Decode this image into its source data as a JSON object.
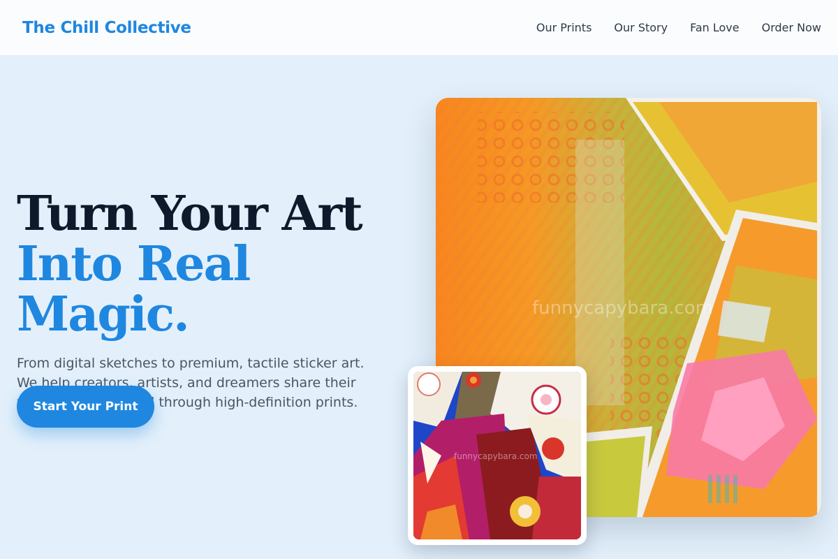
{
  "nav": {
    "brand": "The Chill Collective",
    "links": [
      "Our Prints",
      "Our Story",
      "Fan Love",
      "Order Now"
    ]
  },
  "hero": {
    "headline_line1": "Turn Your Art",
    "headline_line2": "Into Real Magic.",
    "subtext": "From digital sketches to premium, tactile sticker art. We help creators, artists, and dreamers share their vision with the world through high-definition prints.",
    "cta_label": "Start Your Print"
  },
  "artwork": {
    "main_watermark": "funnycapybara.com",
    "small_watermark": "funnycapybara.com"
  },
  "colors": {
    "accent": "#1f87e0",
    "headline_dark": "#0e1a2b",
    "background": "#e3f0fb"
  }
}
